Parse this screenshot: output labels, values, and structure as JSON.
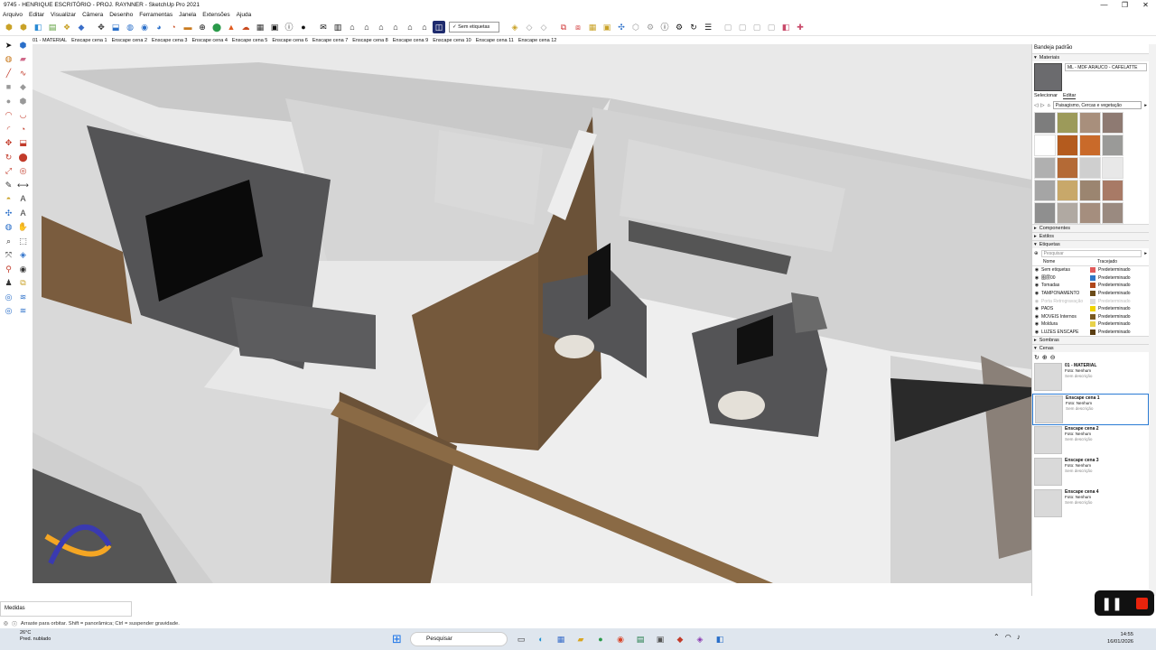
{
  "window": {
    "title": "9745 - HENRIQUE ESCRITÓRIO - PROJ. RAYNNER - SketchUp Pro 2021",
    "controls": [
      "—",
      "❐",
      "✕"
    ]
  },
  "menu": [
    "Arquivo",
    "Editar",
    "Visualizar",
    "Câmera",
    "Desenho",
    "Ferramentas",
    "Janela",
    "Extensões",
    "Ajuda"
  ],
  "toolbar": {
    "tag_select": "✓ Sem etiquetas"
  },
  "scene_tabs": [
    "01 - MATERIAL",
    "Enscape cena 1",
    "Enscape cena 2",
    "Enscape cena 3",
    "Enscape cena 4",
    "Enscape cena 5",
    "Enscape cena 6",
    "Enscape cena 7",
    "Enscape cena 8",
    "Enscape cena 9",
    "Enscape cena 10",
    "Enscape cena 11",
    "Enscape cena 12"
  ],
  "tray": {
    "title": "Bandeja padrão",
    "materials": {
      "header": "Materiais",
      "current": "ML - MDF ARAUCO - CAFELATTE",
      "tabs": [
        "Selecionar",
        "Editar"
      ],
      "library": "Paisagismo, Cercas e vegetação",
      "swatch_colors": [
        "#7d7d7d",
        "#9c9a5a",
        "#a88f7c",
        "#8e7a72",
        "#ffffff",
        "#b45b1e",
        "#c96a2a",
        "#9a9a98",
        "#b0b0b0",
        "#b46a36",
        "#cfcfcf",
        "#e8e8e8",
        "#a5a5a5",
        "#c8a86a",
        "#9b8570",
        "#a87a66",
        "#8f8f8f",
        "#b0a9a2",
        "#a58e7e",
        "#9a8a80",
        "#bdbdbd",
        "#c9b3a6",
        "#b2a39a",
        "#d1d1d1"
      ]
    },
    "components": "Componentes",
    "styles": "Estilos",
    "tags": {
      "header": "Etiquetas",
      "search_placeholder": "Pesquisar",
      "col_name": "Nome",
      "col_dash": "Tracejado",
      "rows": [
        {
          "name": "Sem etiquetas",
          "color": "#e05a5a",
          "dash": "Predeterminado",
          "dim": false
        },
        {
          "name": "图层00",
          "color": "#2e78c7",
          "dash": "Predeterminado",
          "dim": false
        },
        {
          "name": "Tomadas",
          "color": "#b0471b",
          "dash": "Predeterminado",
          "dim": false
        },
        {
          "name": "TAMPONAMENTO",
          "color": "#6b4b18",
          "dash": "Predeterminado",
          "dim": false
        },
        {
          "name": "Porta Retrogravação",
          "color": "#dddddd",
          "dash": "Predeterminado",
          "dim": true
        },
        {
          "name": "PADS",
          "color": "#f0d400",
          "dash": "Predeterminado",
          "dim": false
        },
        {
          "name": "MOVEIS Internos",
          "color": "#7a5a22",
          "dash": "Predeterminado",
          "dim": false
        },
        {
          "name": "Moldura",
          "color": "#e8d24a",
          "dash": "Predeterminado",
          "dim": false
        },
        {
          "name": "LUZES ENSCAPE",
          "color": "#5a3d10",
          "dash": "Predeterminado",
          "dim": false
        }
      ]
    },
    "shadows": "Sombras",
    "scenes": {
      "header": "Cenas",
      "items": [
        {
          "name": "01 - MATERIAL",
          "photo": "Foto: Nenhum",
          "desc": "Sem descrição",
          "selected": false
        },
        {
          "name": "Enscape cena 1",
          "photo": "Foto: Nenhum",
          "desc": "Sem descrição",
          "selected": true
        },
        {
          "name": "Enscape cena 2",
          "photo": "Foto: Nenhum",
          "desc": "Sem descrição",
          "selected": false
        },
        {
          "name": "Enscape cena 3",
          "photo": "Foto: Nenhum",
          "desc": "Sem descrição",
          "selected": false
        },
        {
          "name": "Enscape cena 4",
          "photo": "Foto: Nenhum",
          "desc": "Sem descrição",
          "selected": false
        }
      ]
    }
  },
  "measures": {
    "label": "Medidas"
  },
  "status": {
    "hint": "Arraste para orbitar. Shift = panorâmica; Ctrl = suspender gravidade."
  },
  "taskbar": {
    "weather_temp": "26°C",
    "weather_desc": "Pred. nublado",
    "search": "Pesquisar",
    "time": "14:55",
    "date": "16/01/2026"
  },
  "colors": {
    "selection": "#2a7bd4",
    "record": "#e8230c",
    "wood": "#6b5238",
    "wall": "#d3d3d3"
  }
}
